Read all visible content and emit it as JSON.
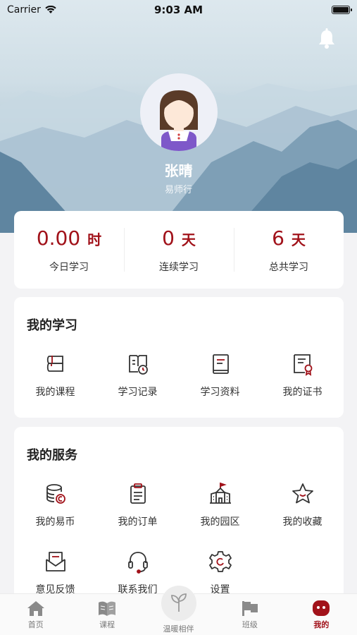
{
  "status_bar": {
    "carrier": "Carrier",
    "time": "9:03 AM"
  },
  "profile": {
    "name": "张晴",
    "role": "易师行"
  },
  "stats": [
    {
      "value": "0.00",
      "unit": "时",
      "label": "今日学习"
    },
    {
      "value": "0",
      "unit": "天",
      "label": "连续学习"
    },
    {
      "value": "6",
      "unit": "天",
      "label": "总共学习"
    }
  ],
  "my_study": {
    "title": "我的学习",
    "items": [
      {
        "label": "我的课程",
        "icon": "course-icon"
      },
      {
        "label": "学习记录",
        "icon": "study-record-icon"
      },
      {
        "label": "学习资料",
        "icon": "study-material-icon"
      },
      {
        "label": "我的证书",
        "icon": "certificate-icon"
      }
    ]
  },
  "my_service": {
    "title": "我的服务",
    "items": [
      {
        "label": "我的易币",
        "icon": "coin-icon"
      },
      {
        "label": "我的订单",
        "icon": "order-icon"
      },
      {
        "label": "我的园区",
        "icon": "school-icon"
      },
      {
        "label": "我的收藏",
        "icon": "star-icon"
      },
      {
        "label": "意见反馈",
        "icon": "feedback-icon"
      },
      {
        "label": "联系我们",
        "icon": "headset-icon"
      },
      {
        "label": "设置",
        "icon": "settings-icon"
      }
    ]
  },
  "tabbar": [
    {
      "label": "首页",
      "icon": "home-icon"
    },
    {
      "label": "课程",
      "icon": "book-icon"
    },
    {
      "label": "温暖相伴",
      "icon": "sprout-icon"
    },
    {
      "label": "班级",
      "icon": "flag-icon"
    },
    {
      "label": "我的",
      "icon": "profile-icon",
      "active": true
    }
  ],
  "colors": {
    "accent": "#a1121a",
    "background": "#f3f3f5"
  }
}
